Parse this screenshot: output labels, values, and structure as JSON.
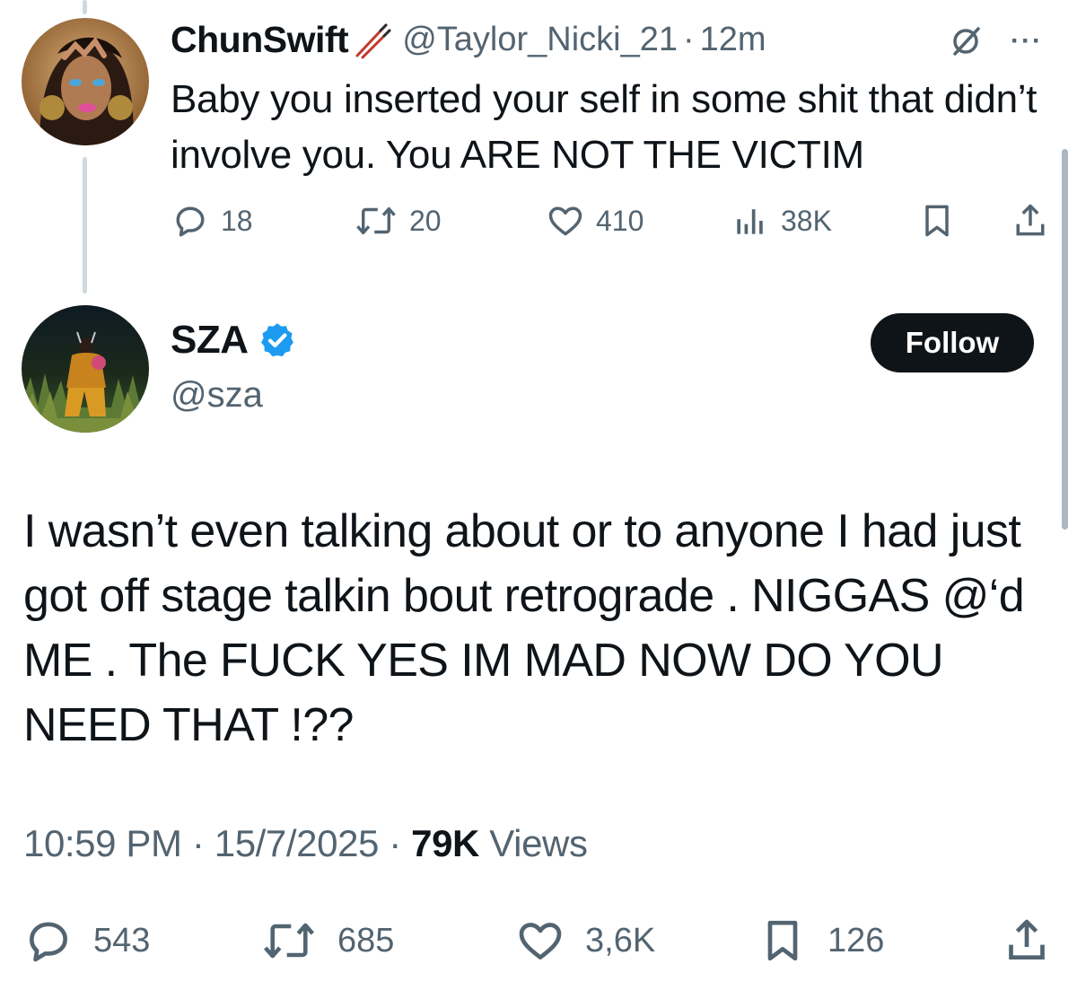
{
  "reply": {
    "display_name": "ChunSwift",
    "name_emoji": "chopsticks-icon",
    "handle": "@Taylor_Nicki_21",
    "separator": "·",
    "time": "12m",
    "text": "Baby you inserted your self in some shit that didn’t involve you. You ARE NOT THE VICTIM",
    "stats": {
      "replies": "18",
      "reposts": "20",
      "likes": "410",
      "views": "38K"
    }
  },
  "main_tweet": {
    "display_name": "SZA",
    "verified": true,
    "handle": "@sza",
    "follow_label": "Follow",
    "text": "I wasn’t even talking about or to anyone I had just got off stage talkin bout retrograde . NIGGAS @‘d ME . The FUCK YES IM MAD NOW DO YOU NEED THAT !??",
    "time": "10:59 PM",
    "date": "15/7/2025",
    "separator": "·",
    "views_count": "79K",
    "views_label": "Views",
    "stats": {
      "replies": "543",
      "reposts": "685",
      "likes": "3,6K",
      "bookmarks": "126"
    }
  },
  "colors": {
    "text": "#0f1419",
    "muted": "#536471",
    "verified": "#1d9bf0",
    "follow_bg": "#0f1419",
    "thread_line": "#cfd9de"
  }
}
